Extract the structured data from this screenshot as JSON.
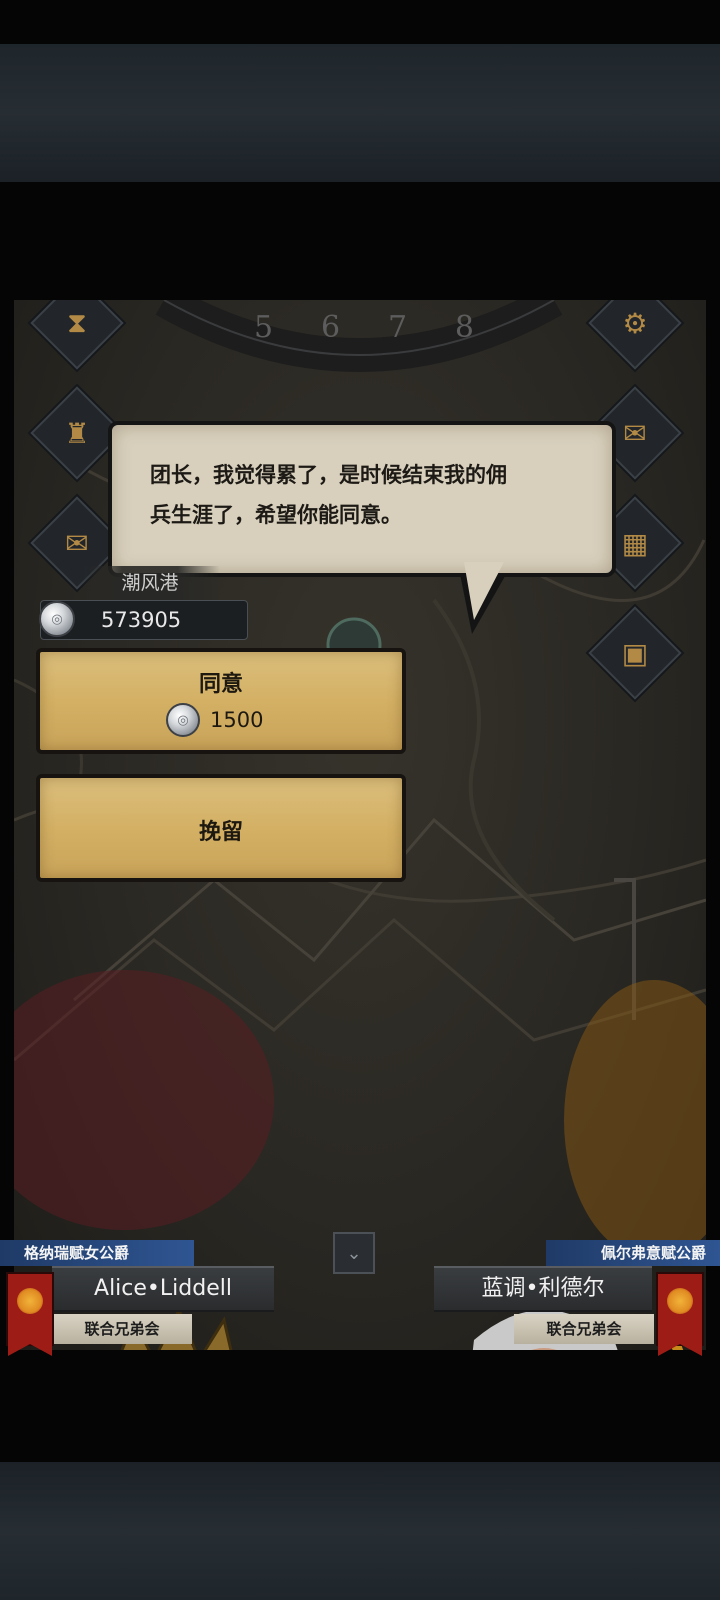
{
  "dialog": {
    "line1": "团长，我觉得累了，是时候结束我的佣",
    "line2": "兵生涯了，希望你能同意。"
  },
  "location": {
    "name": "潮风港"
  },
  "currency": {
    "amount": "573905",
    "icon": "silver-coin-icon"
  },
  "actions": {
    "agree": {
      "label": "同意",
      "cost": "1500",
      "icon": "silver-coin-icon"
    },
    "retain": {
      "label": "挽留"
    }
  },
  "clock": {
    "numerals": [
      "5",
      "6",
      "7",
      "8"
    ]
  },
  "left_hero": {
    "title": "格纳瑞赋女公爵",
    "name": "Alice•Liddell",
    "guild": "联合兄弟会"
  },
  "right_hero": {
    "title": "佩尔弗意赋公爵",
    "name": "蓝调•利德尔",
    "guild": "联合兄弟会"
  },
  "colors": {
    "button_gold": "#d6b46c",
    "dialog_paper": "#d8d0bd",
    "title_blue": "#2f5592",
    "banner_red": "#9e1c16"
  }
}
